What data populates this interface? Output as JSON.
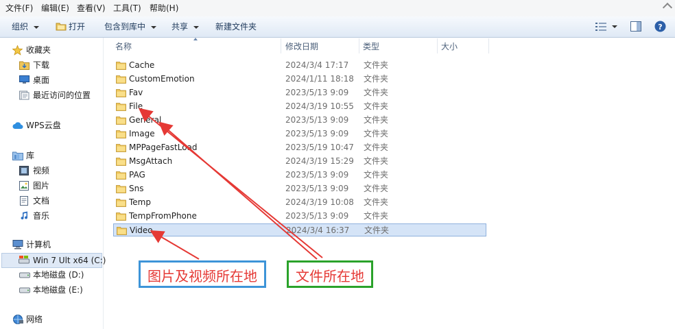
{
  "menu": {
    "items": [
      "文件(F)",
      "编辑(E)",
      "查看(V)",
      "工具(T)",
      "帮助(H)"
    ]
  },
  "toolbar": {
    "organize": "组织",
    "open": "打开",
    "include_library": "包含到库中",
    "share": "共享",
    "new_folder": "新建文件夹"
  },
  "nav": {
    "favorites": "收藏夹",
    "downloads": "下载",
    "desktop": "桌面",
    "recent": "最近访问的位置",
    "wps": "WPS云盘",
    "libraries": "库",
    "videos": "视频",
    "pictures": "图片",
    "documents": "文档",
    "music": "音乐",
    "computer": "计算机",
    "drive_c": "Win 7 Ult x64 (C:)",
    "drive_d": "本地磁盘 (D:)",
    "drive_e": "本地磁盘 (E:)",
    "network": "网络"
  },
  "columns": {
    "name": "名称",
    "modified": "修改日期",
    "type": "类型",
    "size": "大小"
  },
  "files": [
    {
      "name": "Cache",
      "date": "2024/3/4 17:17",
      "type": "文件夹"
    },
    {
      "name": "CustomEmotion",
      "date": "2024/1/11 18:18",
      "type": "文件夹"
    },
    {
      "name": "Fav",
      "date": "2023/5/13 9:09",
      "type": "文件夹"
    },
    {
      "name": "File",
      "date": "2024/3/19 10:55",
      "type": "文件夹"
    },
    {
      "name": "General",
      "date": "2023/5/13 9:09",
      "type": "文件夹"
    },
    {
      "name": "Image",
      "date": "2023/5/13 9:09",
      "type": "文件夹"
    },
    {
      "name": "MPPageFastLoad",
      "date": "2023/5/19 10:47",
      "type": "文件夹"
    },
    {
      "name": "MsgAttach",
      "date": "2024/3/19 15:29",
      "type": "文件夹"
    },
    {
      "name": "PAG",
      "date": "2023/5/13 9:09",
      "type": "文件夹"
    },
    {
      "name": "Sns",
      "date": "2023/5/13 9:09",
      "type": "文件夹"
    },
    {
      "name": "Temp",
      "date": "2024/3/19 10:08",
      "type": "文件夹"
    },
    {
      "name": "TempFromPhone",
      "date": "2023/5/13 9:09",
      "type": "文件夹"
    },
    {
      "name": "Video",
      "date": "2024/3/4 16:37",
      "type": "文件夹"
    }
  ],
  "annotations": {
    "media_location": "图片及视频所在地",
    "file_location": "文件所在地"
  },
  "colors": {
    "accent_selected": "#d5e4f7",
    "annotation_red": "#e53935",
    "annotation_blue_border": "#3d94d8",
    "annotation_green_border": "#2aa22a"
  }
}
